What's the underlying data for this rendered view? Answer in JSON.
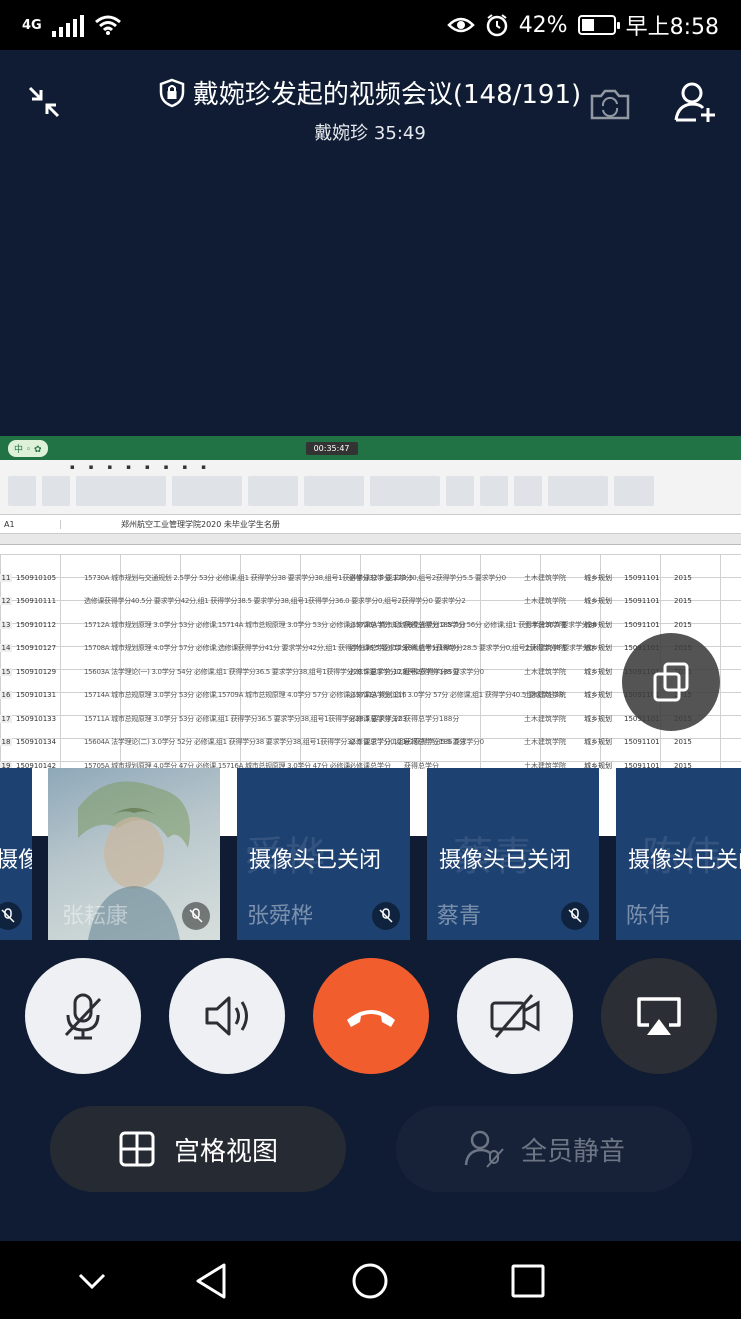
{
  "status_bar": {
    "network": "4G",
    "battery": "42%",
    "battery_level": 0.42,
    "time": "早上8:58"
  },
  "header": {
    "title": "戴婉珍发起的视频会议(148/191)",
    "subtitle": "戴婉珍 35:49"
  },
  "shared_screen": {
    "meeting_timer": "00:35:47",
    "cell_ref": "A1",
    "formula_text": "郑州航空工业管理学院2020 未毕业学生名册",
    "rows": [
      {
        "num": "11",
        "id": "150910105",
        "desc": "15730A 城市规划与交通规划 2.5学分 53分 必修课,组1 获得学分38 要求学分38,组号1获得学分32.5 要求学分0,组号2获得学分5.5 要求学分0",
        "c1": "必修课总学分,123.5",
        "c2": "",
        "c3": "土木建筑学院",
        "c4": "城乡规划",
        "c5": "15091101",
        "c6": "2015"
      },
      {
        "num": "12",
        "id": "150910111",
        "desc": "选修课获得学分40.5分 要求学分42分,组1 获得学分38.5 要求学分38,组号1获得学分36.0 要求学分0,组号2获得学分0 要求学分2",
        "c1": "",
        "c2": "",
        "c3": "土木建筑学院",
        "c4": "城乡规划",
        "c5": "15091101",
        "c6": "2015"
      },
      {
        "num": "13",
        "id": "150910112",
        "desc": "15712A 城市规划原理 3.0学分 53分 必修课,15714A 城市总规原理 3.0学分 53分 必修课,15726A 城市规划与交通规划 2.5学分 56分 必修课,组1 获得学分36.5 要求学分38",
        "c1": "必修课总学分,117.5",
        "c2": "获得总学分188.5分",
        "c3": "土木建筑学院",
        "c4": "城乡规划",
        "c5": "15091101",
        "c6": "2015"
      },
      {
        "num": "14",
        "id": "150910127",
        "desc": "15708A 城市规划原理 4.0学分 57分 必修课,选修课获得学分41分 要求学分42分,组1 获得学分36.5 要求学分38,组号1获得学分28.5 要求学分0,组号2获得学分8 要求学分0",
        "c1": "必修课总学分,123",
        "c2": "获得总学分186分",
        "c3": "土木建筑学院",
        "c4": "城乡规划",
        "c5": "15091101",
        "c6": "2015"
      },
      {
        "num": "15",
        "id": "150910129",
        "desc": "15603A 法学理论(一) 3.0学分 54分 必修课,组1 获得学分36.5 要求学分38,组号1获得学分28.5 要求学分0,组号2获得学分8 要求学分0",
        "c1": "必修课总学分,123",
        "c2": "获得总学分185分",
        "c3": "土木建筑学院",
        "c4": "城乡规划",
        "c5": "15091101",
        "c6": "2015"
      },
      {
        "num": "16",
        "id": "150910131",
        "desc": "15714A 城市总规原理 3.0学分 53分 必修课,15709A 城市总规原理 4.0学分 57分 必修课,15711A 规划设计 3.0学分 57分 必修课,组1 获得学分40.5 要求学分38",
        "c1": "必修课总学分,116",
        "c2": "",
        "c3": "土木建筑学院",
        "c4": "城乡规划",
        "c5": "15091101",
        "c6": "2015"
      },
      {
        "num": "17",
        "id": "150910133",
        "desc": "15711A 城市总规原理 3.0学分 53分 必修课,组1 获得学分36.5 要求学分38,组号1获得学分28.5 要求学分0",
        "c1": "必修课总学分,123",
        "c2": "获得总学分188分",
        "c3": "土木建筑学院",
        "c4": "城乡规划",
        "c5": "15091101",
        "c6": "2015"
      },
      {
        "num": "18",
        "id": "150910134",
        "desc": "15604A 法学理论(二) 3.0学分 52分 必修课,组1 获得学分38 要求学分38,组号1获得学分32.5 要求学分0,组号2获得学分5.5 要求学分0",
        "c1": "必修课总学分,121",
        "c2": "获得总学分186.5分",
        "c3": "土木建筑学院",
        "c4": "城乡规划",
        "c5": "15091101",
        "c6": "2015"
      },
      {
        "num": "19",
        "id": "150910142",
        "desc": "15705A 城市规划原理 4.0学分 47分 必修课,15716A 城市总规原理 3.0学分 47分 必修课",
        "c1": "必修课总学分",
        "c2": "获得总学分",
        "c3": "土木建筑学院",
        "c4": "城乡规划",
        "c5": "15091101",
        "c6": "2015"
      }
    ]
  },
  "participants": [
    {
      "status": "摄像头已关闭",
      "name": "",
      "ghost": ""
    },
    {
      "status": "",
      "name": "张耘康",
      "ghost": ""
    },
    {
      "status": "摄像头已关闭",
      "name": "张舜桦",
      "ghost": "舜桦"
    },
    {
      "status": "摄像头已关闭",
      "name": "蔡青",
      "ghost": "蔡青"
    },
    {
      "status": "摄像头已关闭",
      "name": "陈伟",
      "ghost": "陈伟"
    }
  ],
  "controls": {
    "grid_view_label": "宫格视图",
    "mute_all_label": "全员静音"
  },
  "colors": {
    "background": "#0f1c33",
    "end_call": "#f25d2e",
    "tile": "#1d4171",
    "excel_green": "#217346"
  },
  "icons": [
    "shrink-icon",
    "shield-icon",
    "camera-switch-icon",
    "add-participant-icon",
    "rotate-screen-icon",
    "mic-off-icon",
    "speaker-icon",
    "hang-up-icon",
    "camera-off-icon",
    "screen-share-icon",
    "grid-view-icon",
    "mute-all-icon",
    "back-icon",
    "home-icon",
    "recents-icon"
  ]
}
